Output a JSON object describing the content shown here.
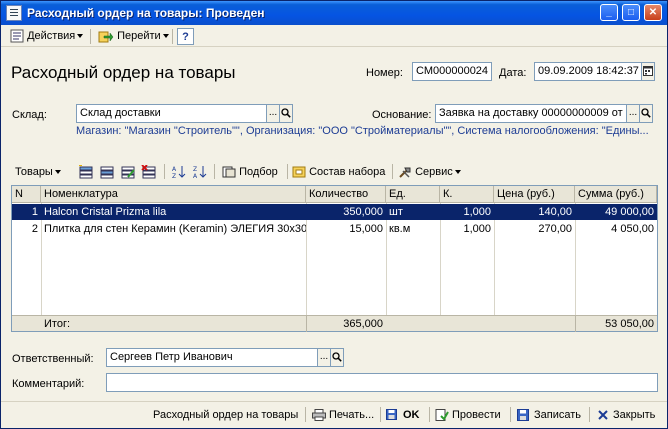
{
  "window": {
    "title": "Расходный ордер на товары: Проведен",
    "controls": {
      "minimize": "_",
      "maximize": "□",
      "close": "✕"
    }
  },
  "menubar": {
    "actions": "Действия",
    "goto": "Перейти",
    "help": "?"
  },
  "form": {
    "heading": "Расходный ордер на товары",
    "number_label": "Номер:",
    "number_value": "СМ000000024",
    "date_label": "Дата:",
    "date_value": "09.09.2009 18:42:37",
    "warehouse_label": "Склад:",
    "warehouse_value": "Склад доставки",
    "basis_label": "Основание:",
    "basis_value": "Заявка на доставку 00000000009 от",
    "info_line": "Магазин: \"Магазин \"Строитель\"\", Организация: \"ООО \"Стройматериалы\"\", Система налогообложения: \"Едины...",
    "ellipsis": "...",
    "search_glyph": "🔍"
  },
  "toolbar": {
    "goods": "Товары",
    "selection": "Подбор",
    "kit": "Состав набора",
    "service": "Сервис"
  },
  "table": {
    "columns": [
      "N",
      "Номенклатура",
      "Количество",
      "Ед.",
      "К.",
      "Цена (руб.)",
      "Сумма (руб.)"
    ],
    "rows": [
      {
        "n": "1",
        "name": "Halcon Cristal Prizma lila",
        "qty": "350,000",
        "unit": "шт",
        "k": "1,000",
        "price": "140,00",
        "sum": "49 000,00"
      },
      {
        "n": "2",
        "name": "Плитка для стен Керамин (Keramin) ЭЛЕГИЯ 30x30",
        "qty": "15,000",
        "unit": "кв.м",
        "k": "1,000",
        "price": "270,00",
        "sum": "4 050,00"
      }
    ],
    "total_label": "Итог:",
    "total_qty": "365,000",
    "total_sum": "53 050,00"
  },
  "bottom": {
    "responsible_label": "Ответственный:",
    "responsible_value": "Сергеев Петр Иванович",
    "comment_label": "Комментарий:",
    "comment_value": ""
  },
  "bottom_bar": {
    "print_form": "Расходный ордер на товары",
    "print": "Печать...",
    "ok": "OK",
    "post": "Провести",
    "save": "Записать",
    "close": "Закрыть"
  },
  "colors": {
    "titlebar": "#0554e3",
    "selected_row": "#0a246a",
    "info_text": "#1c3c94",
    "window_bg": "#f3f1e6"
  }
}
